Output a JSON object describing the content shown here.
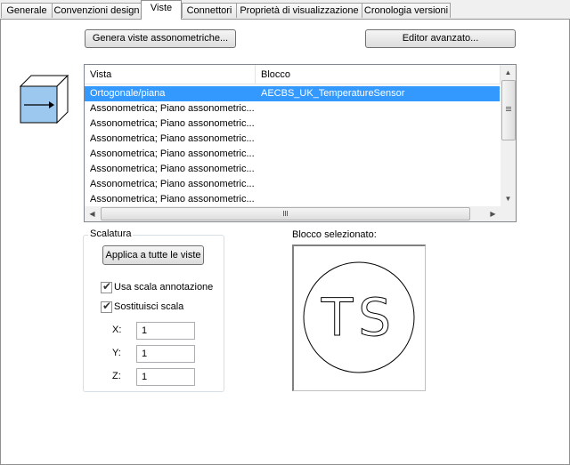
{
  "tabs": [
    {
      "label": "Generale"
    },
    {
      "label": "Convenzioni design"
    },
    {
      "label": "Viste"
    },
    {
      "label": "Connettori"
    },
    {
      "label": "Proprietà di visualizzazione"
    },
    {
      "label": "Cronologia versioni"
    }
  ],
  "toolbar": {
    "generate_label": "Genera viste assonometriche...",
    "editor_label": "Editor avanzato..."
  },
  "views_list": {
    "columns": [
      "Vista",
      "Blocco"
    ],
    "rows": [
      {
        "vista": "Ortogonale/piana",
        "blocco": "AECBS_UK_TemperatureSensor"
      },
      {
        "vista": "Assonometrica; Piano assonometric...",
        "blocco": ""
      },
      {
        "vista": "Assonometrica; Piano assonometric...",
        "blocco": ""
      },
      {
        "vista": "Assonometrica; Piano assonometric...",
        "blocco": ""
      },
      {
        "vista": "Assonometrica; Piano assonometric...",
        "blocco": ""
      },
      {
        "vista": "Assonometrica; Piano assonometric...",
        "blocco": ""
      },
      {
        "vista": "Assonometrica; Piano assonometric...",
        "blocco": ""
      },
      {
        "vista": "Assonometrica; Piano assonometric...",
        "blocco": ""
      }
    ]
  },
  "scaling": {
    "title": "Scalatura",
    "apply_label": "Applica a tutte le viste",
    "use_annotation_scale": "Usa scala annotazione",
    "override_scale": "Sostituisci scala",
    "x_label": "X:",
    "y_label": "Y:",
    "z_label": "Z:",
    "x_value": "1",
    "y_value": "1",
    "z_value": "1"
  },
  "selected_block": {
    "label": "Blocco selezionato:",
    "symbol_text": "TS"
  },
  "colors": {
    "selection": "#3399ff",
    "view_icon_face": "#9cc7ee"
  }
}
